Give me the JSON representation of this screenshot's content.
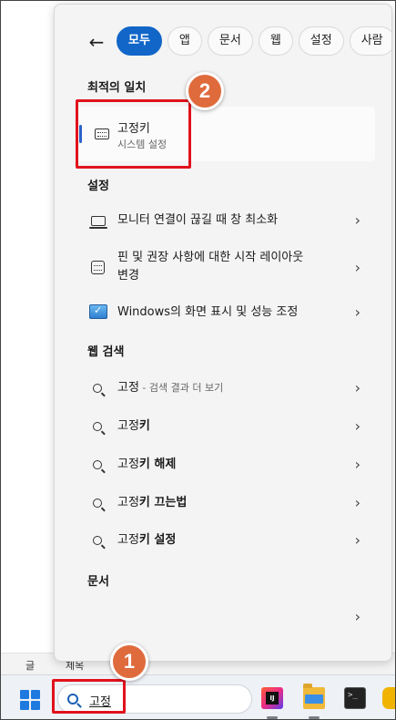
{
  "background_app": {
    "text_left": "글",
    "text_right": "제목"
  },
  "panel": {
    "filters": [
      "모두",
      "앱",
      "문서",
      "웹",
      "설정",
      "사람"
    ],
    "active_filter": "모두",
    "best_match": {
      "heading": "최적의 일치",
      "title": "고정키",
      "subtitle": "시스템 설정",
      "icon": "keyboard-icon"
    },
    "settings": {
      "heading": "설정",
      "items": [
        {
          "label": "모니터 연결이 끊길 때 창 최소화",
          "icon": "monitor-icon"
        },
        {
          "label_line1": "핀 및 권장 사항에 대한 시작 레이아웃",
          "label_line2": "변경",
          "icon": "start-layout-icon"
        },
        {
          "label": "Windows의 화면 표시 및 성능 조정",
          "icon": "performance-options-icon"
        }
      ]
    },
    "web": {
      "heading": "웹 검색",
      "items": [
        {
          "plain": "고정",
          "hint": " - 검색 결과 더 보기"
        },
        {
          "plain": "고정",
          "bold": "키"
        },
        {
          "plain": "고정",
          "bold": "키 해제"
        },
        {
          "plain": "고정",
          "bold": "키 끄는법"
        },
        {
          "plain": "고정",
          "bold": "키 설정"
        }
      ]
    },
    "documents": {
      "heading": "문서"
    }
  },
  "annotations": {
    "badge1": "1",
    "badge2": "2",
    "mark_color": "#e1121c",
    "badge_color": "#df6b3d"
  },
  "taskbar": {
    "search_query": "고정",
    "apps": [
      "intellij-icon",
      "file-explorer-icon",
      "terminal-icon"
    ]
  }
}
